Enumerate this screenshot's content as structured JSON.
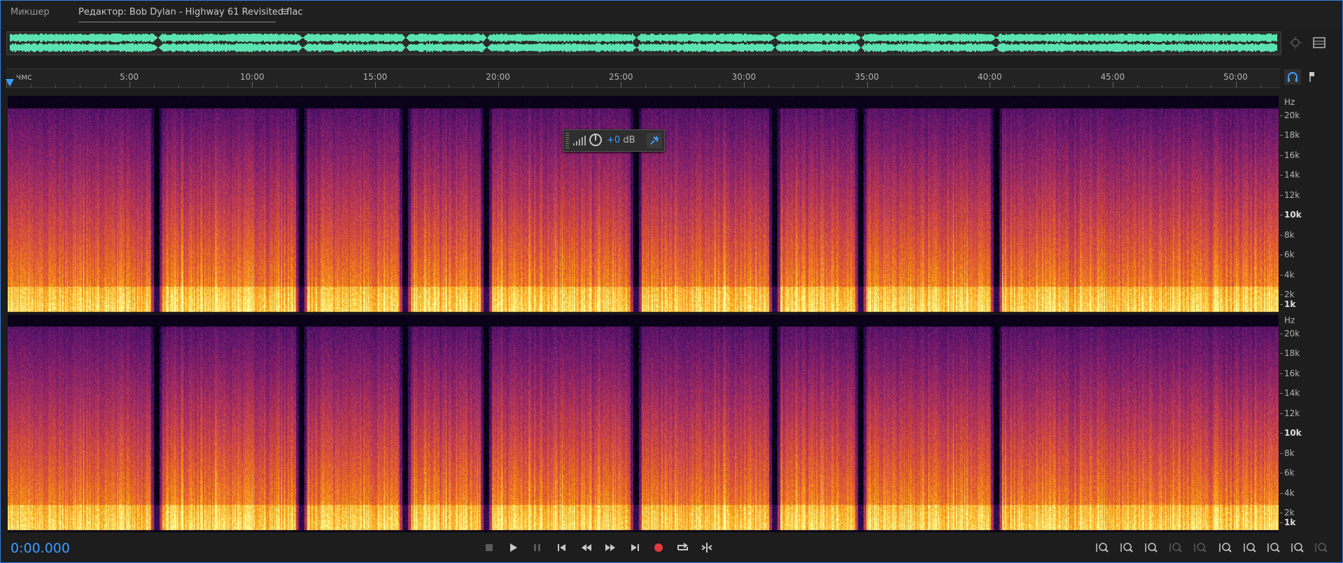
{
  "tabs": {
    "mixer_label": "Микшер",
    "editor_label": "Редактор: Bob Dylan - Highway 61 Revisited.flac"
  },
  "ruler": {
    "unit_label": "чмс",
    "ticks": [
      "5:00",
      "10:00",
      "15:00",
      "20:00",
      "25:00",
      "30:00",
      "35:00",
      "40:00",
      "45:00",
      "50:00"
    ]
  },
  "frequency_axis": {
    "unit": "Hz",
    "labels": [
      "20k",
      "18k",
      "16k",
      "14k",
      "12k",
      "10k",
      "8k",
      "6k",
      "4k",
      "2k",
      "1k"
    ],
    "bold_labels": [
      "10k",
      "1k"
    ]
  },
  "hud": {
    "gain_value": "+0",
    "gain_unit": "dB"
  },
  "transport": {
    "current_time": "0:00.000",
    "buttons": [
      "stop-icon",
      "play-icon",
      "pause-icon",
      "go-to-start-icon",
      "rewind-icon",
      "fast-forward-icon",
      "go-to-end-icon",
      "record-icon",
      "loop-playback-icon",
      "skip-selection-icon"
    ]
  },
  "zoom_controls": {
    "buttons": [
      "zoom-in-amplitude-icon",
      "zoom-out-amplitude-icon",
      "zoom-in-time-icon",
      "zoom-out-time-icon",
      "zoom-full-icon",
      "zoom-in-left-icon",
      "zoom-in-right-icon",
      "zoom-selection-icon",
      "zoom-reset-icon",
      "zoom-tracks-icon"
    ]
  },
  "colors": {
    "accent": "#3d9bff",
    "record": "#e5383b",
    "overview_wave": "#5be3b4",
    "ruler_marker": "#3d9bff"
  },
  "track": {
    "track_boundaries_min": [
      6.05,
      11.95,
      16.15,
      19.45,
      25.55,
      31.2,
      34.7,
      40.2
    ]
  }
}
